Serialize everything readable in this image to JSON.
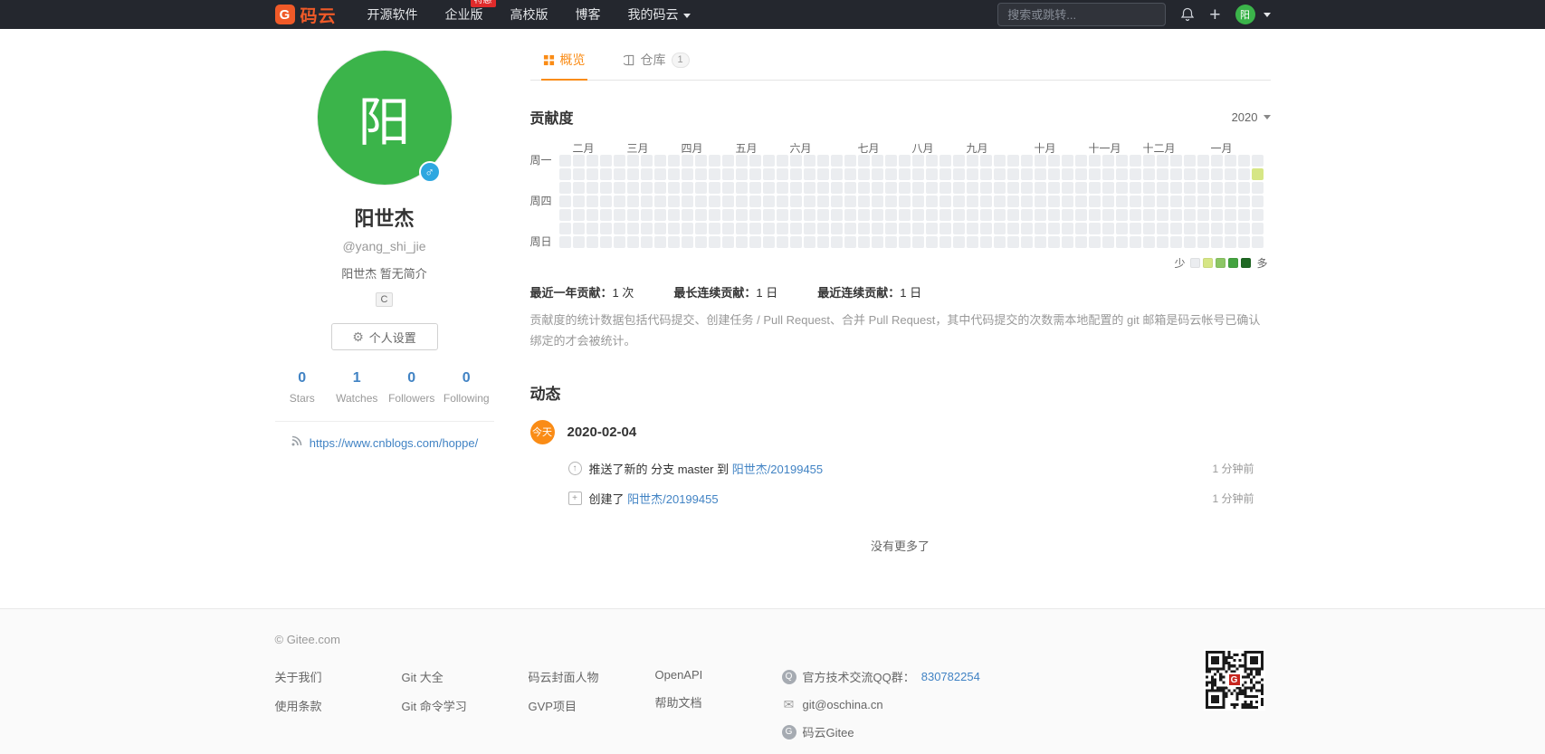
{
  "colors": {
    "brand": "#f05a28",
    "accent": "#fa8c16",
    "link": "#4183c4",
    "green": "#3bb44a",
    "gender_blue": "#2ea7e0",
    "badge_red": "#e02b2b",
    "qr_red": "#c7261f"
  },
  "navbar": {
    "logo_letter": "G",
    "brand": "码云",
    "links": [
      {
        "label": "开源软件"
      },
      {
        "label": "企业版",
        "badge": "特惠"
      },
      {
        "label": "高校版"
      },
      {
        "label": "博客"
      },
      {
        "label": "我的码云",
        "caret": true
      }
    ],
    "search_placeholder": "搜索或跳转...",
    "avatar_text": "阳"
  },
  "profile": {
    "avatar_text": "阳",
    "gender_symbol": "♂",
    "name": "阳世杰",
    "username": "@yang_shi_jie",
    "bio": "阳世杰 暂无简介",
    "language_badge": "C",
    "settings_button": "个人设置",
    "stats": [
      {
        "value": "0",
        "label": "Stars"
      },
      {
        "value": "1",
        "label": "Watches"
      },
      {
        "value": "0",
        "label": "Followers"
      },
      {
        "value": "0",
        "label": "Following"
      }
    ],
    "website": "https://www.cnblogs.com/hoppe/"
  },
  "tabs": [
    {
      "label": "概览",
      "active": true
    },
    {
      "label": "仓库",
      "count": "1"
    }
  ],
  "contributions": {
    "title": "贡献度",
    "year": "2020",
    "months": [
      "二月",
      "三月",
      "四月",
      "五月",
      "六月",
      "七月",
      "八月",
      "九月",
      "十月",
      "十一月",
      "十二月",
      "一月"
    ],
    "month_cols": [
      1,
      5,
      9,
      13,
      17,
      22,
      26,
      30,
      35,
      39,
      43,
      48
    ],
    "day_labels": [
      {
        "label": "周一",
        "row": 0
      },
      {
        "label": "周四",
        "row": 3
      },
      {
        "label": "周日",
        "row": 6
      }
    ],
    "grid": {
      "cols": 52,
      "rows": 7,
      "filled": [
        {
          "col": 51,
          "row": 1,
          "level": 1
        }
      ]
    },
    "colors": [
      "#ebedf0",
      "#d6e685",
      "#8cc665",
      "#44a340",
      "#1e6823"
    ],
    "legend": {
      "less": "少",
      "more": "多"
    },
    "summary": [
      {
        "label": "最近一年贡献：",
        "value": "1 次"
      },
      {
        "label": "最长连续贡献：",
        "value": "1 日"
      },
      {
        "label": "最近连续贡献：",
        "value": "1 日"
      }
    ],
    "note": "贡献度的统计数据包括代码提交、创建任务 / Pull Request、合并 Pull Request，其中代码提交的次数需本地配置的 git 邮箱是码云帐号已确认绑定的才会被统计。"
  },
  "activity": {
    "title": "动态",
    "day_badge": "今天",
    "date": "2020-02-04",
    "items": [
      {
        "icon": "push",
        "parts": [
          {
            "text": "推送了新的 分支 master 到 ",
            "type": "text"
          },
          {
            "text": "阳世杰/20199455",
            "type": "link"
          }
        ],
        "time": "1 分钟前"
      },
      {
        "icon": "repo",
        "parts": [
          {
            "text": "创建了 ",
            "type": "text"
          },
          {
            "text": "阳世杰/20199455",
            "type": "link"
          }
        ],
        "time": "1 分钟前"
      }
    ],
    "no_more": "没有更多了"
  },
  "footer": {
    "copyright": "© Gitee.com",
    "columns": [
      {
        "links": [
          "关于我们",
          "使用条款"
        ]
      },
      {
        "links": [
          "Git 大全",
          "Git 命令学习"
        ]
      },
      {
        "links": [
          "码云封面人物",
          "GVP项目"
        ]
      },
      {
        "links": [
          "OpenAPI",
          "帮助文档"
        ]
      }
    ],
    "contacts": [
      {
        "icon": "qq-icon",
        "parts": [
          {
            "text": "官方技术交流QQ群：",
            "type": "text"
          },
          {
            "text": "830782254",
            "type": "link"
          }
        ]
      },
      {
        "icon": "mail-icon",
        "parts": [
          {
            "text": "git@oschina.cn",
            "type": "text"
          }
        ]
      },
      {
        "icon": "gitee-icon",
        "parts": [
          {
            "text": "码云Gitee",
            "type": "text"
          }
        ]
      }
    ]
  }
}
